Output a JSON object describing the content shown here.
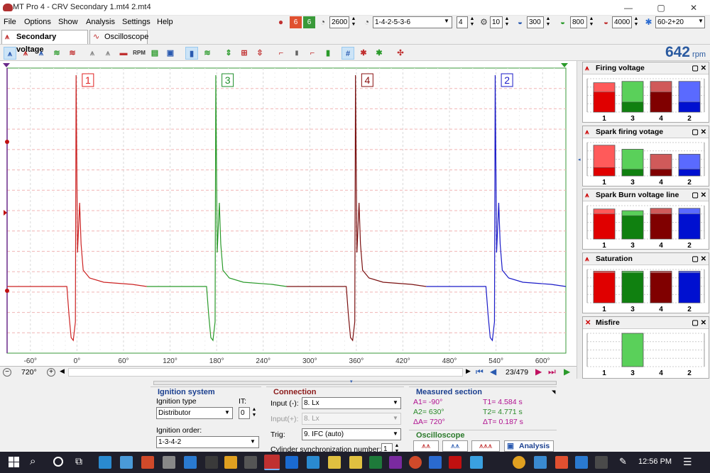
{
  "window": {
    "title": "MT Pro 4 - CRV Secondary 1.mt4 2.mt4",
    "min": "—",
    "max": "▢",
    "close": "✕"
  },
  "menu": [
    "File",
    "Options",
    "Show",
    "Analysis",
    "Settings",
    "Help"
  ],
  "toolbar": {
    "rpm_limit": "2600",
    "firing_order": "1-4-2-5-3-6",
    "cylinders": "4",
    "cycles": "10",
    "v_low": "300",
    "v_mid": "800",
    "v_high": "4000",
    "trigger_wheel": "60-2+20"
  },
  "tabs": {
    "secondary": "Secondary voltage",
    "oscilloscope": "Oscilloscope"
  },
  "rpm": {
    "value": "642",
    "unit": "rpm"
  },
  "chart_data": {
    "type": "line",
    "x_unit": "degrees",
    "xlim": [
      -90,
      630
    ],
    "x_ticks": [
      "-60°",
      "0°",
      "60°",
      "120°",
      "180°",
      "240°",
      "300°",
      "360°",
      "420°",
      "480°",
      "540°",
      "600°"
    ],
    "cylinder_markers": [
      {
        "label": "1",
        "x": 5,
        "color": "#e02020"
      },
      {
        "label": "3",
        "x": 185,
        "color": "#1e8e2a"
      },
      {
        "label": "4",
        "x": 365,
        "color": "#8a1010"
      },
      {
        "label": "2",
        "x": 545,
        "color": "#1a1ac8"
      }
    ],
    "series": [
      {
        "color": "#cc2222",
        "x_start": -90,
        "x_end": 90,
        "spike_at": -2
      },
      {
        "color": "#2a9a2a",
        "x_start": 90,
        "x_end": 270,
        "spike_at": 178
      },
      {
        "color": "#7a1010",
        "x_start": 270,
        "x_end": 450,
        "spike_at": 358
      },
      {
        "color": "#1a1ac8",
        "x_start": 450,
        "x_end": 630,
        "spike_at": 538
      }
    ]
  },
  "status": {
    "zoom": "720°",
    "page": "23/479"
  },
  "panels": [
    {
      "title": "Firing voltage",
      "labels": [
        "1",
        "3",
        "4",
        "2"
      ],
      "levels": [
        0.88,
        0.92,
        0.92,
        0.92
      ],
      "inner": [
        0.6,
        0.3,
        0.6,
        0.3
      ]
    },
    {
      "title": "Spark firing votage",
      "labels": [
        "1",
        "3",
        "4",
        "2"
      ],
      "levels": [
        0.92,
        0.8,
        0.65,
        0.65
      ],
      "inner": [
        0.25,
        0.2,
        0.2,
        0.2
      ]
    },
    {
      "title": "Spark Burn voltage line",
      "labels": [
        "1",
        "3",
        "4",
        "2"
      ],
      "levels": [
        0.9,
        0.85,
        0.92,
        0.92
      ],
      "inner": [
        0.75,
        0.7,
        0.75,
        0.75
      ]
    },
    {
      "title": "Saturation",
      "labels": [
        "1",
        "3",
        "4",
        "2"
      ],
      "levels": [
        0.95,
        0.95,
        0.95,
        0.95
      ],
      "inner": [
        0.9,
        0.9,
        0.9,
        0.9
      ]
    },
    {
      "title": "Misfire",
      "labels": [
        "1",
        "3",
        "4",
        "2"
      ],
      "levels": [
        0,
        1,
        0,
        0
      ],
      "inner": [
        0,
        0,
        0,
        0
      ]
    }
  ],
  "ignition": {
    "title": "Ignition system",
    "type_label": "Ignition type",
    "type_value": "Distributor",
    "it_label": "IT:",
    "it_value": "0",
    "order_label": "Ignition order:",
    "order_value": "1-3-4-2"
  },
  "connection": {
    "title": "Connection",
    "input_minus_label": "Input (-):",
    "input_minus": "8. Lx",
    "input_plus_label": "Input(+):",
    "input_plus": "8. Lx",
    "trig_label": "Trig:",
    "trig": "9. IFC (auto)",
    "sync_label": "Cylinder synchronization number:",
    "sync": "1"
  },
  "measured": {
    "title": "Measured section",
    "a1": "A1= -90°",
    "a2": "A2= 630°",
    "da": "ΔA= 720°",
    "t1": "T1= 4.584 s",
    "t2": "T2= 4.771 s",
    "dt": "ΔT= 0.187 s"
  },
  "osc": {
    "title": "Oscilloscope",
    "analysis": "Analysis"
  },
  "taskbar": {
    "time": "12:56 PM"
  }
}
